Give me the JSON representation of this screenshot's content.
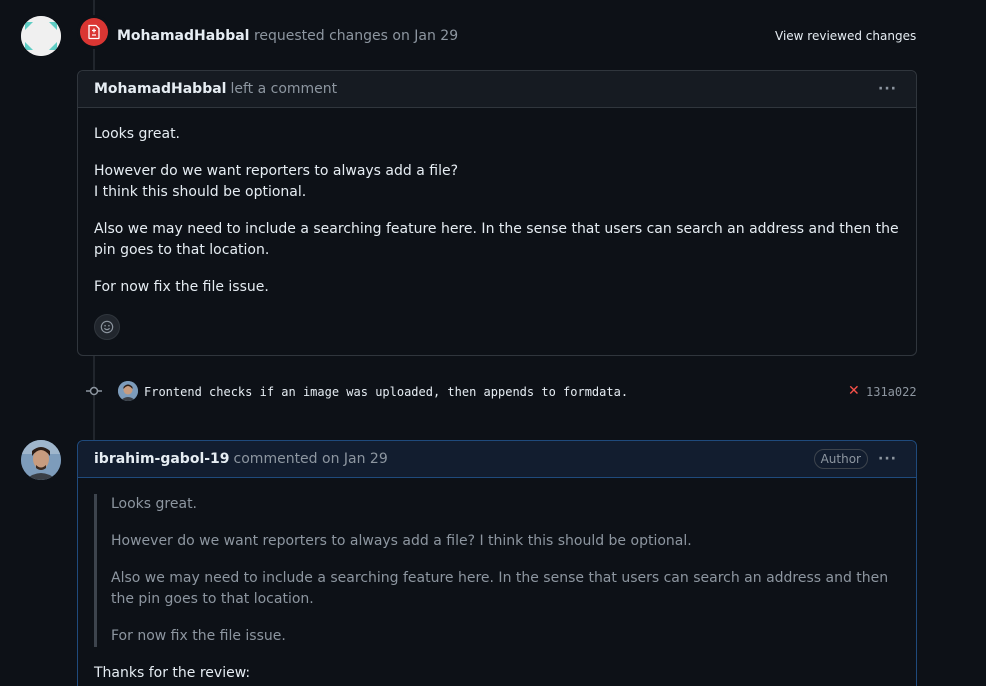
{
  "review": {
    "author": "MohamadHabbal",
    "action_text": "requested changes on Jan 29",
    "view_reviewed_label": "View reviewed changes",
    "status_color": "#da3633",
    "icon": "file-diff-icon"
  },
  "comment1": {
    "author": "MohamadHabbal",
    "action": "left a comment",
    "paragraphs": [
      "Looks great.",
      "However do we want reporters to always add a file?",
      "I think this should be optional.",
      "Also we may need to include a searching feature here. In the sense that users can search an address and then the pin goes to that location.",
      "For now fix the file issue."
    ],
    "reaction_icon": "smiley-icon"
  },
  "commit": {
    "message": "Frontend checks if an image was uploaded, then appends to formdata.",
    "status_icon": "x-icon",
    "status_color": "#f85149",
    "sha": "131a022"
  },
  "comment2": {
    "author": "ibrahim-gabol-19",
    "action": "commented on Jan 29",
    "badge": "Author",
    "quote": [
      "Looks great.",
      "However do we want reporters to always add a file? I think this should be optional.",
      "Also we may need to include a searching feature here. In the sense that users can search an address and then the pin goes to that location.",
      "For now fix the file issue."
    ],
    "reply": "Thanks for the review:"
  }
}
